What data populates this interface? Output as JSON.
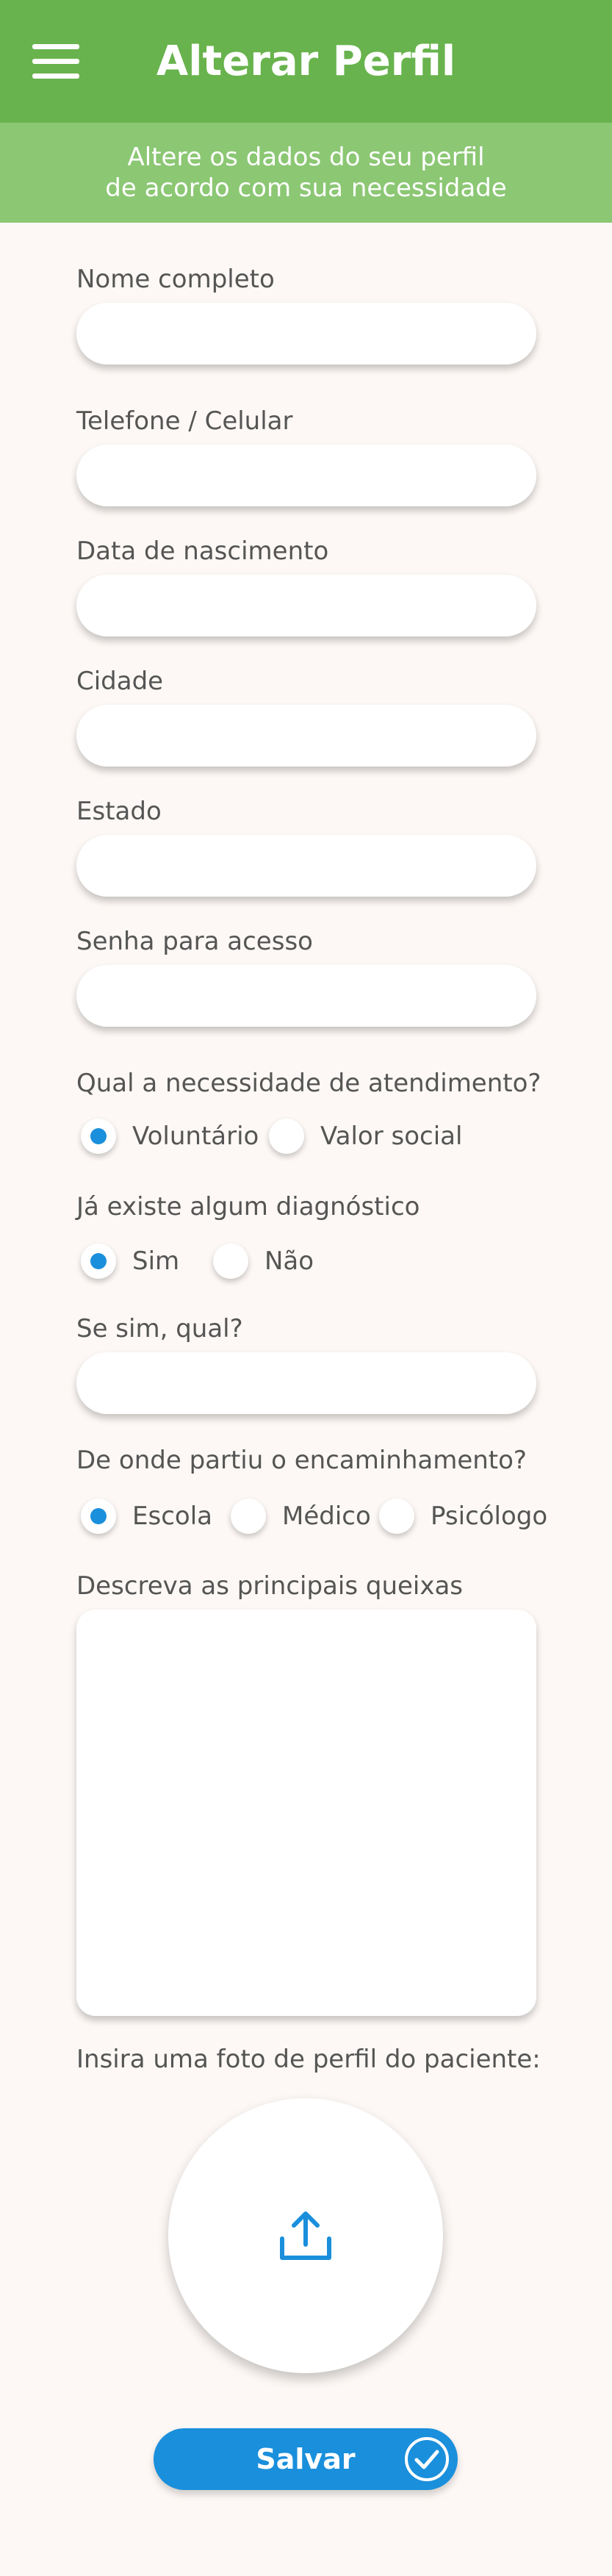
{
  "header": {
    "title": "Alterar Perfil",
    "menu_icon": "hamburger-menu-icon",
    "color": "#68b34d"
  },
  "subheader": {
    "line1": "Altere os dados do seu perfil",
    "line2": "de acordo com sua necessidade",
    "color": "#8cc774"
  },
  "fields": {
    "nome": {
      "label": "Nome completo",
      "value": ""
    },
    "telefone": {
      "label": "Telefone / Celular",
      "value": ""
    },
    "nascimento": {
      "label": "Data de nascimento",
      "value": ""
    },
    "cidade": {
      "label": "Cidade",
      "value": ""
    },
    "estado": {
      "label": "Estado",
      "value": ""
    },
    "senha": {
      "label": "Senha para acesso",
      "value": ""
    },
    "qual": {
      "label": "Se sim, qual?",
      "value": ""
    },
    "queixas": {
      "label": "Descreva as principais queixas",
      "value": ""
    }
  },
  "atendimento": {
    "question": "Qual a necessidade de atendimento?",
    "options": [
      "Voluntário",
      "Valor social"
    ],
    "selected": "Voluntário"
  },
  "diagnostico": {
    "question": "Já existe algum diagnóstico",
    "options": [
      "Sim",
      "Não"
    ],
    "selected": "Sim"
  },
  "encaminhamento": {
    "question": "De onde partiu o encaminhamento?",
    "options": [
      "Escola",
      "Médico",
      "Psicólogo"
    ],
    "selected": "Escola"
  },
  "photo": {
    "label": "Insira uma foto de perfil do paciente:",
    "icon": "upload-icon"
  },
  "save": {
    "label": "Salvar",
    "icon": "check-circle-icon",
    "color": "#1a8fdc"
  }
}
